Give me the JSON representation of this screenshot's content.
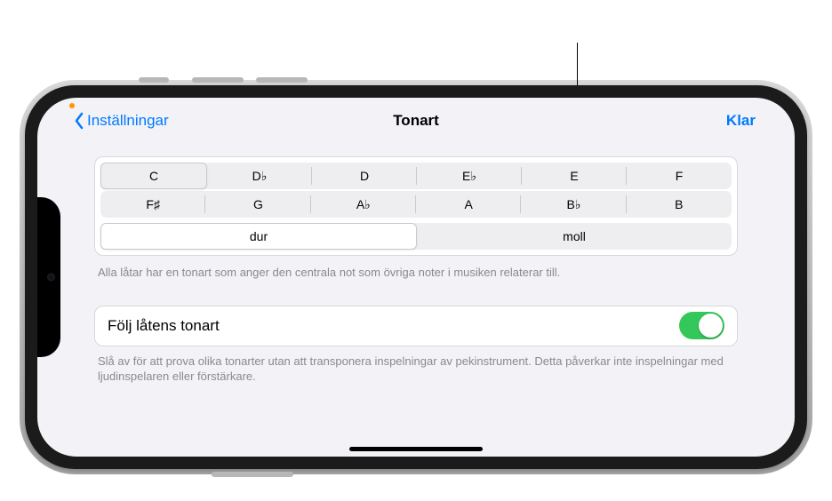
{
  "nav": {
    "back_label": "Inställningar",
    "title": "Tonart",
    "done_label": "Klar"
  },
  "keys_row1": [
    "C",
    "D♭",
    "D",
    "E♭",
    "E",
    "F"
  ],
  "keys_row2": [
    "F♯",
    "G",
    "A♭",
    "A",
    "B♭",
    "B"
  ],
  "selected_key_index": 0,
  "mode": {
    "major": "dur",
    "minor": "moll"
  },
  "selected_mode": "major",
  "key_footnote": "Alla låtar har en tonart som anger den centrala not som övriga noter i musiken relaterar till.",
  "follow": {
    "label": "Följ låtens tonart",
    "enabled": true,
    "footnote": "Slå av för att prova olika tonarter utan att transponera inspelningar av pekinstrument. Detta påverkar inte inspelningar med ljudinspelaren eller förstärkare."
  }
}
